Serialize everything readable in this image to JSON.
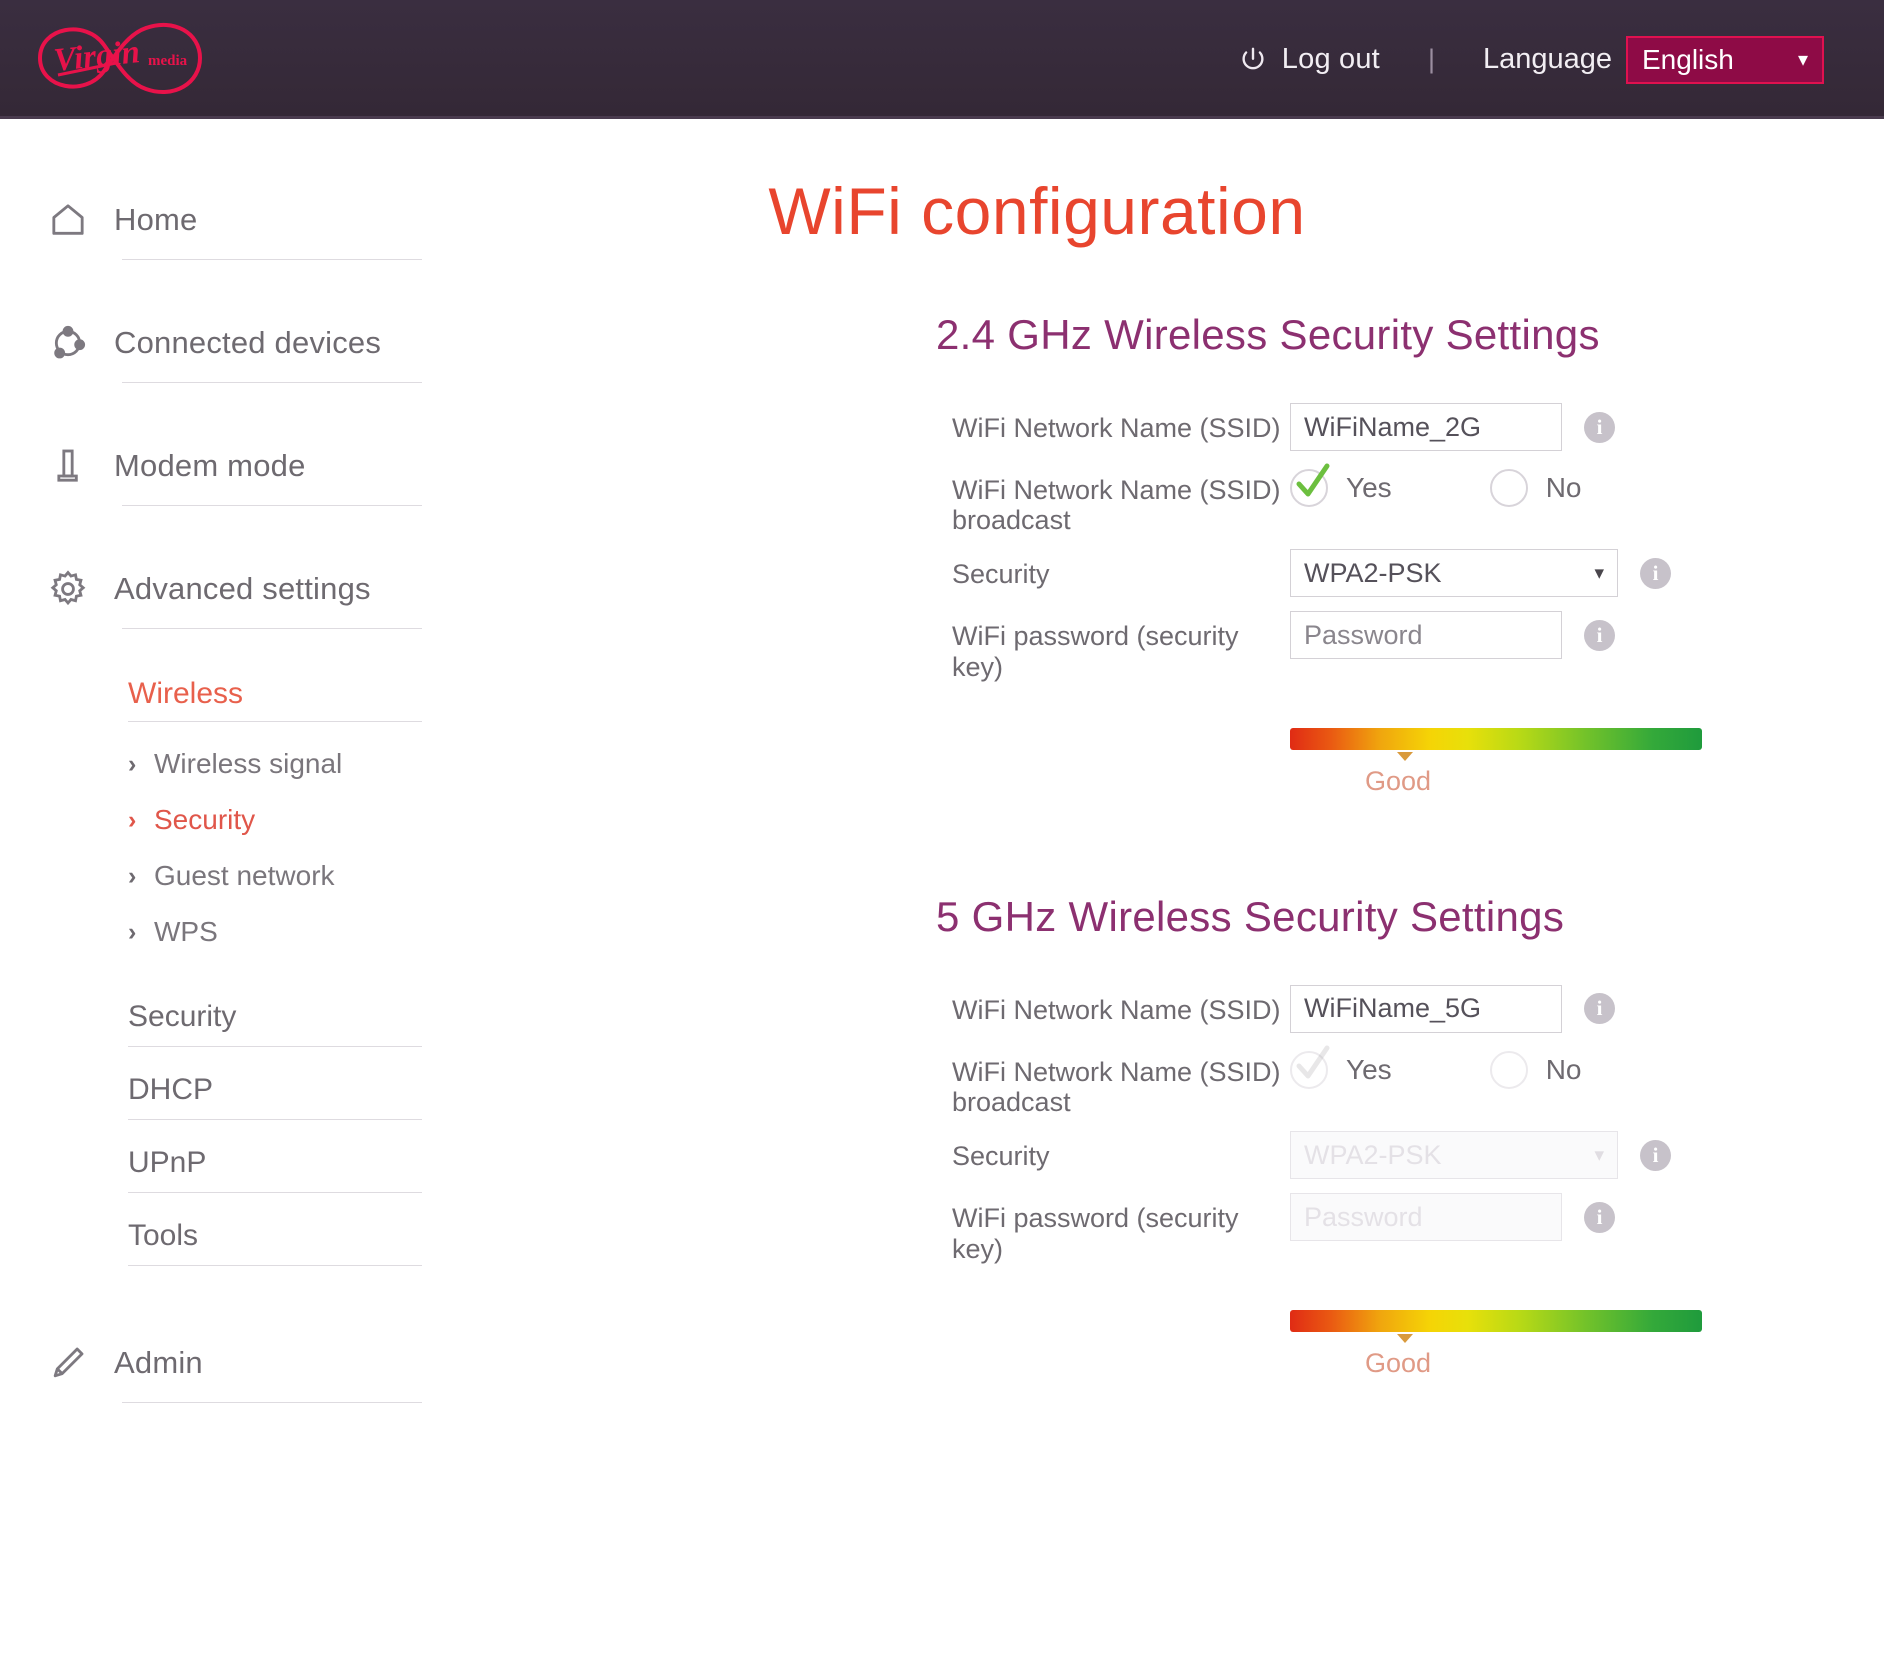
{
  "header": {
    "brand_name": "Virgin Media",
    "brand_wordmark": "Virgin",
    "brand_subword": "media",
    "power_icon": "power-icon",
    "logout_label": "Log out",
    "separator": "|",
    "language_label": "Language",
    "language_value": "English",
    "language_chevron": "chevron-down-icon",
    "bar_color": "#362A3B",
    "accent_color": "#e0114f"
  },
  "sidebar": {
    "main_items": [
      {
        "label": "Home",
        "icon": "home-icon"
      },
      {
        "label": "Connected devices",
        "icon": "connected-devices-icon"
      },
      {
        "label": "Modem mode",
        "icon": "modem-icon"
      },
      {
        "label": "Advanced settings",
        "icon": "gear-icon"
      }
    ],
    "subnav_header": "Wireless",
    "sub_items": [
      {
        "label": "Wireless signal",
        "active": false
      },
      {
        "label": "Security",
        "active": true
      },
      {
        "label": "Guest network",
        "active": false
      },
      {
        "label": "WPS",
        "active": false
      }
    ],
    "plain_items": [
      "Security",
      "DHCP",
      "UPnP",
      "Tools"
    ],
    "admin": {
      "label": "Admin",
      "icon": "pencil-icon"
    },
    "active_color": "#e0564a",
    "text_color": "#6e6a70"
  },
  "main": {
    "page_title": "WiFi configuration",
    "page_title_color": "#e8452e",
    "section_color": "#8c3070",
    "sections": [
      {
        "title": "2.4 GHz Wireless Security Settings",
        "ssid_label": "WiFi Network Name (SSID)",
        "ssid_value": "WiFiName_2G",
        "broadcast_label": "WiFi Network Name (SSID) broadcast",
        "broadcast_yes": "Yes",
        "broadcast_no": "No",
        "broadcast_selected": "Yes",
        "security_label": "Security",
        "security_value": "WPA2-PSK",
        "security_options": [
          "WPA2-PSK"
        ],
        "password_label": "WiFi password (security key)",
        "password_placeholder": "Password",
        "password_value": "",
        "strength_label": "Good",
        "strength_percent": 28,
        "info_icon": "info-icon",
        "disabled": false
      },
      {
        "title": "5 GHz Wireless Security Settings",
        "ssid_label": "WiFi Network Name (SSID)",
        "ssid_value": "WiFiName_5G",
        "broadcast_label": "WiFi Network Name (SSID) broadcast",
        "broadcast_yes": "Yes",
        "broadcast_no": "No",
        "broadcast_selected": "Yes",
        "security_label": "Security",
        "security_value": "WPA2-PSK",
        "security_options": [
          "WPA2-PSK"
        ],
        "password_label": "WiFi password (security key)",
        "password_placeholder": "Password",
        "password_value": "",
        "strength_label": "Good",
        "strength_percent": 28,
        "info_icon": "info-icon",
        "disabled": true
      }
    ]
  }
}
